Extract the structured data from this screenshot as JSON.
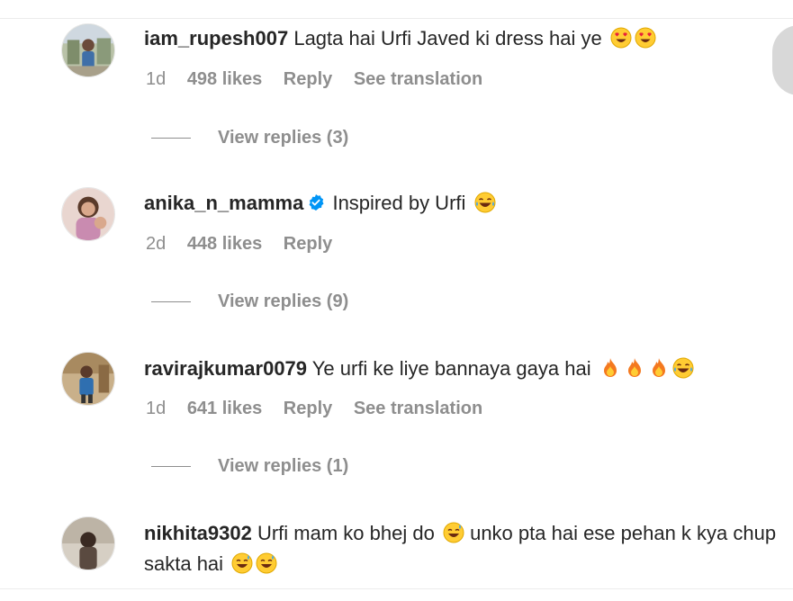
{
  "comments": [
    {
      "username": "iam_rupesh007",
      "verified": false,
      "text": "Lagta hai Urfi Javed ki dress hai ye",
      "emojis": [
        "heart-eyes-emoji",
        "heart-eyes-emoji"
      ],
      "time": "1d",
      "likes": "498 likes",
      "reply": "Reply",
      "translation": "See translation",
      "view_replies": "View replies (3)"
    },
    {
      "username": "anika_n_mamma",
      "verified": true,
      "text": "Inspired by Urfi",
      "emojis": [
        "laughing-tears-emoji"
      ],
      "time": "2d",
      "likes": "448 likes",
      "reply": "Reply",
      "view_replies": "View replies (9)"
    },
    {
      "username": "ravirajkumar0079",
      "verified": false,
      "text": "Ye urfi ke liye bannaya gaya hai",
      "emojis": [
        "fire-emoji",
        "fire-emoji",
        "fire-emoji",
        "laughing-tears-emoji"
      ],
      "time": "1d",
      "likes": "641 likes",
      "reply": "Reply",
      "translation": "See translation",
      "view_replies": "View replies (1)"
    },
    {
      "username": "nikhita9302",
      "verified": false,
      "text_part1": "Urfi mam ko bhej do",
      "text_part2": "unko pta hai ese pehan k kya chup sakta hai",
      "emojis": [
        "sweat-smile-emoji",
        "sweat-smile-emoji",
        "sweat-smile-emoji"
      ]
    }
  ],
  "colors": {
    "text": "#262626",
    "muted": "#8e8e8e",
    "verified": "#0095f6"
  }
}
